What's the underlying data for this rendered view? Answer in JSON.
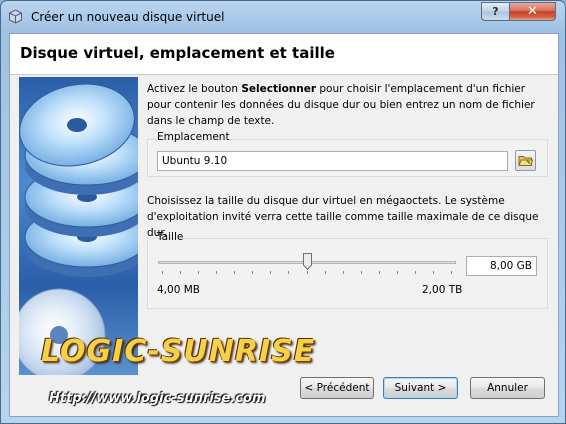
{
  "window": {
    "title": "Créer un nouveau disque virtuel",
    "help_label": "?",
    "close_label": "✕"
  },
  "header": {
    "title": "Disque virtuel, emplacement et taille"
  },
  "description": {
    "before": "Activez le bouton ",
    "bold": "Selectionner",
    "after": " pour choisir l'emplacement d'un fichier pour contenir les données du disque dur ou bien entrez un nom de fichier dans le champ de texte."
  },
  "location": {
    "label": "Emplacement",
    "value": "Ubuntu 9.10",
    "folder_icon": "folder-icon"
  },
  "size_description": "Choisissez la taille du disque dur virtuel en mégaoctets. Le système d'exploitation invité verra cette taille comme taille maximale de ce disque dur.",
  "size": {
    "label": "Taille",
    "value": "8,00 GB",
    "slider_fraction": 0.5,
    "min_label": "4,00 MB",
    "max_label": "2,00 TB"
  },
  "buttons": {
    "previous": "< Précédent",
    "next": "Suivant >",
    "cancel": "Annuler"
  },
  "watermark": {
    "logo_text": "LOGIC-SUNRISE",
    "url_text": "Http://www.logic-sunrise.com"
  },
  "colors": {
    "accent": "#3c7fb1",
    "titlebar": "#a9c8e8",
    "close": "#c2432a"
  }
}
